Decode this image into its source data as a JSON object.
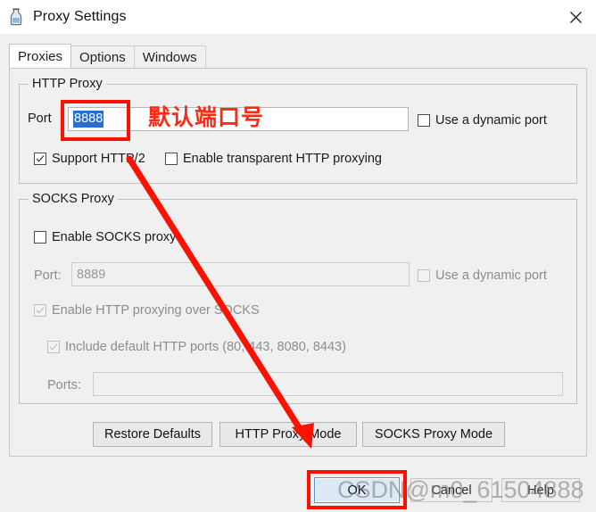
{
  "window": {
    "title": "Proxy Settings",
    "icon": "charles-bottle-icon",
    "close_label": "✕"
  },
  "tabs": [
    {
      "label": "Proxies",
      "active": true
    },
    {
      "label": "Options",
      "active": false
    },
    {
      "label": "Windows",
      "active": false
    }
  ],
  "http_group": {
    "title": "HTTP Proxy",
    "port_label": "Port",
    "port_value": "8888",
    "dynamic_port_label": "Use a dynamic port",
    "dynamic_port_checked": false,
    "support_http2_label": "Support HTTP/2",
    "support_http2_checked": true,
    "transparent_label": "Enable transparent HTTP proxying",
    "transparent_checked": false
  },
  "socks_group": {
    "title": "SOCKS Proxy",
    "enable_label": "Enable SOCKS proxy",
    "enable_checked": false,
    "port_label": "Port:",
    "port_value": "8889",
    "dynamic_port_label": "Use a dynamic port",
    "dynamic_port_checked": false,
    "http_over_socks_label": "Enable HTTP proxying over SOCKS",
    "http_over_socks_checked": true,
    "default_ports_label": "Include default HTTP ports (80, 443, 8080, 8443)",
    "default_ports_checked": true,
    "ports_label": "Ports:",
    "ports_value": ""
  },
  "mode_buttons": {
    "restore_defaults": "Restore Defaults",
    "http_proxy_mode": "HTTP Proxy Mode",
    "socks_proxy_mode": "SOCKS Proxy Mode"
  },
  "dialog_buttons": {
    "ok": "OK",
    "cancel": "Cancel",
    "help": "Help"
  },
  "annotations": {
    "port_note": "默认端口号",
    "highlight_color": "#fb1100"
  },
  "watermark": {
    "text": "CSDN@m0_61504888"
  }
}
